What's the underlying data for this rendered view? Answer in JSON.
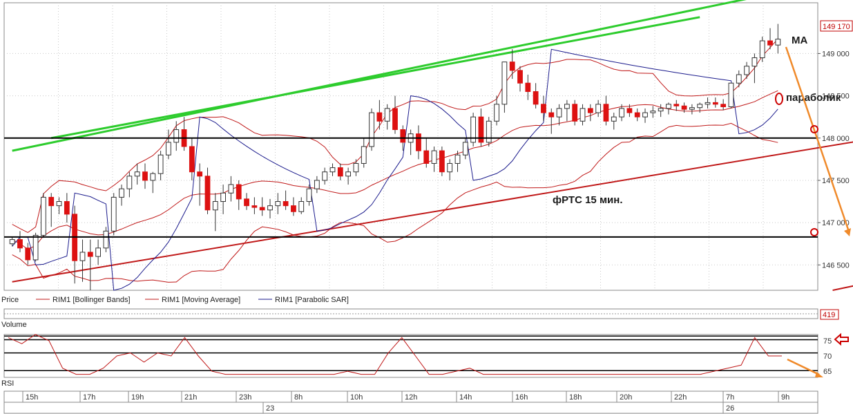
{
  "chart_data": [
    {
      "type": "candlestick",
      "panel": "price",
      "title": "фРТС   15 мин.",
      "ylim": [
        146200,
        149600
      ],
      "yticks": [
        "149 000",
        "148 500",
        "148 000",
        "147 500",
        "147 000",
        "146 500"
      ],
      "ytick_values": [
        149000,
        148500,
        148000,
        147500,
        147000,
        146500
      ],
      "last_price_label": "149 170",
      "last_price": 149170,
      "horizontal_levels": [
        148000,
        146830
      ],
      "trendlines": [
        {
          "color": "#2dcc2d",
          "from": [
            0,
            147850
          ],
          "to": [
            100,
            149760
          ]
        },
        {
          "color": "#2dcc2d",
          "from": [
            5,
            148000
          ],
          "to": [
            88,
            149430
          ]
        },
        {
          "color": "#c01818",
          "from": [
            0,
            146300
          ],
          "to": [
            138,
            148420
          ]
        },
        {
          "color": "#c01818",
          "from": [
            105,
            146200
          ],
          "to": [
            138,
            146840
          ]
        }
      ],
      "indicators_legend": [
        {
          "label": "Price",
          "color": "#000000"
        },
        {
          "label": "RIM1 [Bollinger Bands]",
          "color": "#c01818"
        },
        {
          "label": "RIM1 [Moving Average]",
          "color": "#c01818"
        },
        {
          "label": "RIM1 [Parabolic SAR]",
          "color": "#1a1a8c"
        }
      ],
      "annotations": {
        "ma": "MA",
        "parabolic": "параболик",
        "timeframe": "фРТС   15 мин."
      },
      "candles": [
        [
          146750,
          146830,
          146720,
          146800
        ],
        [
          146800,
          146900,
          146650,
          146700
        ],
        [
          146700,
          146760,
          146500,
          146560
        ],
        [
          146560,
          146880,
          146540,
          146850
        ],
        [
          146850,
          147350,
          146820,
          147300
        ],
        [
          147300,
          147350,
          146950,
          147200
        ],
        [
          147200,
          147300,
          147100,
          147250
        ],
        [
          147250,
          147350,
          147000,
          147100
        ],
        [
          147100,
          147200,
          146280,
          146550
        ],
        [
          146550,
          146800,
          146300,
          146650
        ],
        [
          146650,
          146800,
          146200,
          146600
        ],
        [
          146600,
          146800,
          146500,
          146700
        ],
        [
          146700,
          146950,
          146650,
          146900
        ],
        [
          146900,
          147350,
          146850,
          147300
        ],
        [
          147300,
          147450,
          147200,
          147400
        ],
        [
          147400,
          147600,
          147300,
          147550
        ],
        [
          147550,
          147700,
          147450,
          147600
        ],
        [
          147600,
          147700,
          147400,
          147500
        ],
        [
          147500,
          147600,
          147350,
          147580
        ],
        [
          147580,
          147850,
          147500,
          147800
        ],
        [
          147800,
          148100,
          147750,
          147950
        ],
        [
          147950,
          148200,
          147850,
          148100
        ],
        [
          148100,
          148250,
          147850,
          147900
        ],
        [
          147900,
          148000,
          147500,
          147600
        ],
        [
          147600,
          147700,
          147200,
          147550
        ],
        [
          147550,
          147650,
          147100,
          147150
        ],
        [
          147150,
          147350,
          146900,
          147250
        ],
        [
          147250,
          147450,
          147100,
          147350
        ],
        [
          147350,
          147550,
          147250,
          147450
        ],
        [
          147450,
          147500,
          147150,
          147280
        ],
        [
          147280,
          147350,
          147150,
          147200
        ],
        [
          147200,
          147300,
          147100,
          147180
        ],
        [
          147180,
          147300,
          147080,
          147150
        ],
        [
          147150,
          147280,
          147050,
          147200
        ],
        [
          147200,
          147350,
          147100,
          147250
        ],
        [
          147250,
          147380,
          147150,
          147200
        ],
        [
          147200,
          147300,
          147080,
          147130
        ],
        [
          147130,
          147300,
          147100,
          147250
        ],
        [
          147250,
          147450,
          147200,
          147400
        ],
        [
          147400,
          147550,
          147350,
          147500
        ],
        [
          147500,
          147650,
          147450,
          147600
        ],
        [
          147600,
          147700,
          147550,
          147650
        ],
        [
          147650,
          147700,
          147500,
          147550
        ],
        [
          147550,
          147650,
          147450,
          147600
        ],
        [
          147600,
          147750,
          147550,
          147700
        ],
        [
          147700,
          148000,
          147650,
          147900
        ],
        [
          147900,
          148350,
          147850,
          148300
        ],
        [
          148300,
          148450,
          148100,
          148200
        ],
        [
          148200,
          148400,
          148100,
          148350
        ],
        [
          148350,
          148500,
          148050,
          148100
        ],
        [
          148100,
          148150,
          147850,
          147950
        ],
        [
          147950,
          148100,
          147800,
          148050
        ],
        [
          148050,
          148150,
          147750,
          147850
        ],
        [
          147850,
          148000,
          147650,
          147700
        ],
        [
          147700,
          147900,
          147600,
          147850
        ],
        [
          147850,
          147900,
          147550,
          147600
        ],
        [
          147600,
          147750,
          147500,
          147700
        ],
        [
          147700,
          147850,
          147600,
          147800
        ],
        [
          147800,
          148000,
          147750,
          147950
        ],
        [
          147950,
          148300,
          147900,
          148250
        ],
        [
          148250,
          148350,
          147900,
          147950
        ],
        [
          147950,
          148250,
          147900,
          148200
        ],
        [
          148200,
          148500,
          148150,
          148400
        ],
        [
          148400,
          148800,
          148300,
          148900
        ],
        [
          148900,
          149050,
          148700,
          148800
        ],
        [
          148800,
          148850,
          148550,
          148650
        ],
        [
          148650,
          148750,
          148450,
          148550
        ],
        [
          148550,
          148650,
          148350,
          148400
        ],
        [
          148400,
          148500,
          148200,
          148300
        ],
        [
          148300,
          148350,
          148050,
          148250
        ],
        [
          148250,
          148400,
          148150,
          148350
        ],
        [
          148350,
          148450,
          148200,
          148400
        ],
        [
          148400,
          148450,
          148150,
          148200
        ],
        [
          148200,
          148400,
          148150,
          148350
        ],
        [
          148350,
          148400,
          148200,
          148300
        ],
        [
          148300,
          148450,
          148250,
          148400
        ],
        [
          148400,
          148500,
          148150,
          148200
        ],
        [
          148200,
          148300,
          148100,
          148250
        ],
        [
          148250,
          148400,
          148200,
          148350
        ],
        [
          148350,
          148400,
          148250,
          148300
        ],
        [
          148300,
          148350,
          148200,
          148250
        ],
        [
          148250,
          148350,
          148180,
          148300
        ],
        [
          148300,
          148380,
          148240,
          148320
        ],
        [
          148320,
          148400,
          148250,
          148350
        ],
        [
          148350,
          148420,
          148280,
          148400
        ],
        [
          148400,
          148450,
          148320,
          148380
        ],
        [
          148380,
          148420,
          148300,
          148340
        ],
        [
          148340,
          148400,
          148280,
          148360
        ],
        [
          148360,
          148420,
          148300,
          148400
        ],
        [
          148400,
          148480,
          148350,
          148420
        ],
        [
          148420,
          148480,
          148360,
          148400
        ],
        [
          148400,
          148460,
          148330,
          148370
        ],
        [
          148370,
          148650,
          148350,
          148650
        ],
        [
          148650,
          148800,
          148600,
          148750
        ],
        [
          148750,
          148900,
          148700,
          148850
        ],
        [
          148850,
          149000,
          148650,
          148950
        ],
        [
          148950,
          149200,
          148900,
          149150
        ],
        [
          149150,
          149300,
          149050,
          149100
        ],
        [
          149100,
          149350,
          149000,
          149170
        ]
      ]
    },
    {
      "type": "bar",
      "panel": "volume",
      "title": "Volume",
      "last_value_label": "419",
      "last_value": 419
    },
    {
      "type": "line",
      "panel": "oscillator",
      "title": "RSI",
      "ylim": [
        63,
        77
      ],
      "yticks": [
        "75",
        "70",
        "65"
      ],
      "ytick_values": [
        75,
        70,
        65
      ],
      "horizontal_levels": [
        76.5,
        75.3,
        71,
        65.2
      ],
      "series": [
        {
          "values": [
            76,
            74,
            77,
            75,
            66,
            64,
            64,
            66,
            70,
            71,
            68,
            71,
            70,
            76,
            70,
            65,
            64,
            64,
            64,
            64,
            64,
            64,
            64,
            64,
            64,
            65,
            64,
            64,
            71,
            76,
            70,
            64,
            64,
            65,
            66,
            64,
            64,
            64,
            64,
            64,
            64,
            64,
            64,
            64,
            64,
            64,
            64,
            64,
            64,
            64,
            64,
            64,
            65,
            66,
            67,
            76,
            70,
            70
          ]
        }
      ]
    }
  ],
  "time_axis": {
    "hour_labels": [
      "15h",
      "17h",
      "19h",
      "21h",
      "23h",
      "8h",
      "10h",
      "12h",
      "14h",
      "16h",
      "18h",
      "20h",
      "22h",
      "7h",
      "9h"
    ],
    "date_labels": [
      "23",
      "26"
    ]
  },
  "colors": {
    "bull": "#ffffff",
    "bear": "#dd1111",
    "grid": "#c8c8c8",
    "bollinger": "#c01818",
    "moving_average": "#c01818",
    "parabolic_sar": "#1a1a8c",
    "green_trend": "#2dcc2d",
    "red_trend": "#c01818",
    "forecast_arrow": "#f08a2a"
  }
}
